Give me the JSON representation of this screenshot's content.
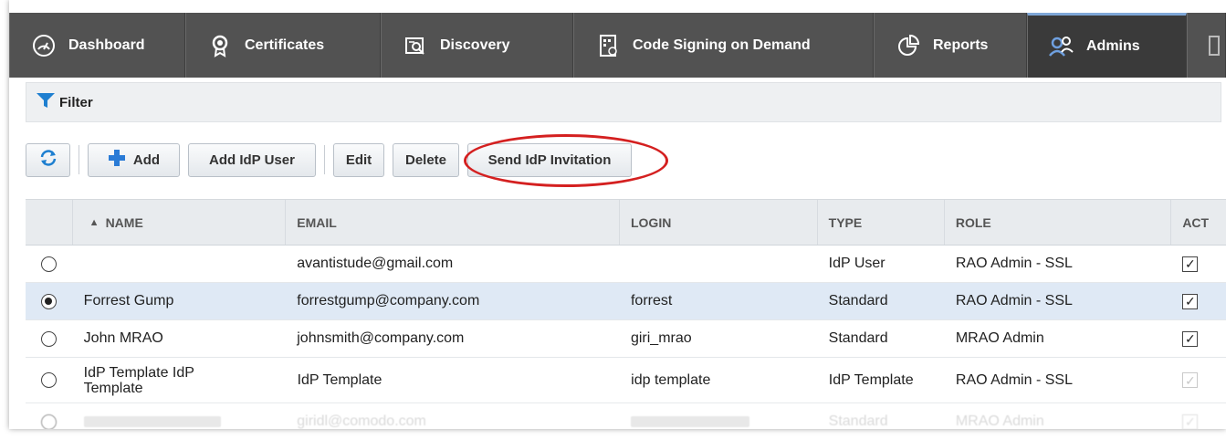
{
  "nav": {
    "tabs": [
      {
        "label": "Dashboard",
        "icon": "gauge-icon"
      },
      {
        "label": "Certificates",
        "icon": "certificate-icon"
      },
      {
        "label": "Discovery",
        "icon": "discovery-icon"
      },
      {
        "label": "Code Signing on Demand",
        "icon": "code-signing-icon"
      },
      {
        "label": "Reports",
        "icon": "reports-icon"
      },
      {
        "label": "Admins",
        "icon": "admins-icon"
      }
    ],
    "active": "Admins"
  },
  "filter": {
    "label": "Filter"
  },
  "toolbar": {
    "add": "Add",
    "add_idp_user": "Add IdP User",
    "edit": "Edit",
    "delete": "Delete",
    "send_idp_invitation": "Send IdP Invitation"
  },
  "table": {
    "columns": [
      "NAME",
      "EMAIL",
      "LOGIN",
      "TYPE",
      "ROLE",
      "ACT"
    ],
    "sort_indicator": "▲",
    "rows": [
      {
        "selected": false,
        "name": "",
        "email": "avantistude@gmail.com",
        "login": "",
        "type": "IdP User",
        "role": "RAO Admin - SSL",
        "active": true
      },
      {
        "selected": true,
        "name": "Forrest Gump",
        "email": "forrestgump@company.com",
        "login": "forrest",
        "type": "Standard",
        "role": "RAO Admin - SSL",
        "active": true
      },
      {
        "selected": false,
        "name": "John MRAO",
        "email": "johnsmith@company.com",
        "login": "giri_mrao",
        "type": "Standard",
        "role": "MRAO Admin",
        "active": true
      },
      {
        "selected": false,
        "name": "IdP Template IdP Template",
        "email": "IdP Template",
        "login": "idp template",
        "type": "IdP Template",
        "role": "RAO Admin - SSL",
        "active": true
      },
      {
        "selected": false,
        "name": "",
        "email": "giridl@comodo.com",
        "login": "",
        "type": "Standard",
        "role": "MRAO Admin",
        "active": true
      }
    ]
  },
  "colors": {
    "nav_bg": "#525252",
    "selected_row": "#dfe9f5",
    "callout": "#d42020",
    "add_plus": "#2a7bd6"
  }
}
